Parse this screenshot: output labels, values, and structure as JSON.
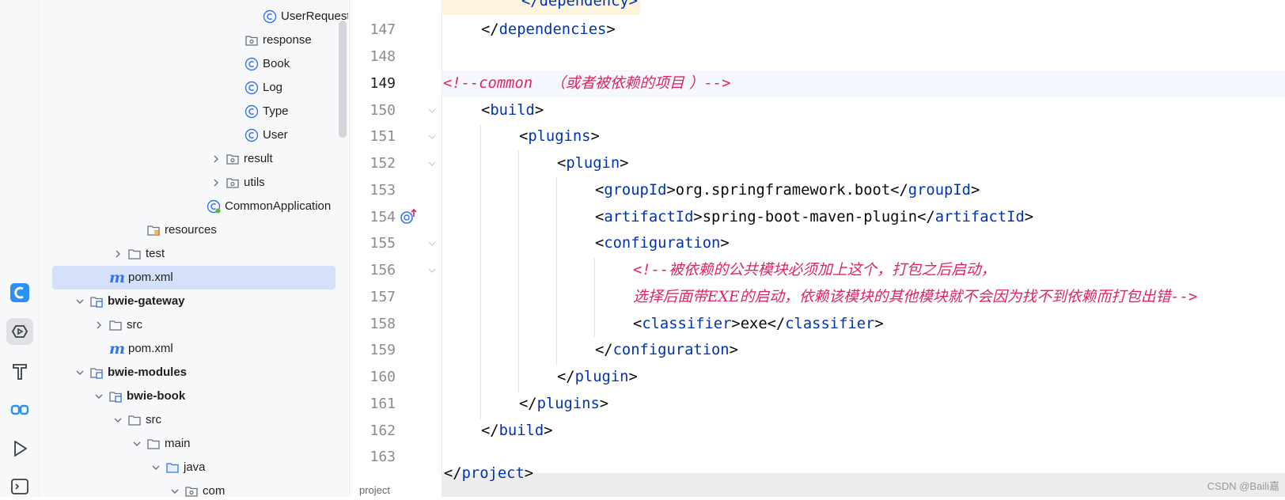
{
  "tree": {
    "items": [
      {
        "label": "UserRequest",
        "icon": "class-icon"
      },
      {
        "label": "response",
        "icon": "package-icon"
      },
      {
        "label": "Book",
        "icon": "class-icon"
      },
      {
        "label": "Log",
        "icon": "class-icon"
      },
      {
        "label": "Type",
        "icon": "class-icon"
      },
      {
        "label": "User",
        "icon": "class-icon"
      },
      {
        "label": "result",
        "icon": "package-icon"
      },
      {
        "label": "utils",
        "icon": "package-icon"
      },
      {
        "label": "CommonApplication",
        "icon": "spring-boot-class-icon"
      },
      {
        "label": "resources",
        "icon": "resources-folder-icon"
      },
      {
        "label": "test",
        "icon": "folder-icon"
      },
      {
        "label": "pom.xml",
        "icon": "maven-icon"
      },
      {
        "label": "bwie-gateway",
        "icon": "module-icon"
      },
      {
        "label": "src",
        "icon": "folder-icon"
      },
      {
        "label": "pom.xml",
        "icon": "maven-icon"
      },
      {
        "label": "bwie-modules",
        "icon": "module-icon"
      },
      {
        "label": "bwie-book",
        "icon": "module-icon"
      },
      {
        "label": "src",
        "icon": "folder-icon"
      },
      {
        "label": "main",
        "icon": "folder-icon"
      },
      {
        "label": "java",
        "icon": "source-folder-icon"
      },
      {
        "label": "com",
        "icon": "package-icon"
      }
    ],
    "maven_glyph": "m"
  },
  "editor": {
    "line_numbers": [
      "147",
      "148",
      "149",
      "150",
      "151",
      "152",
      "153",
      "154",
      "155",
      "156",
      "157",
      "158",
      "159",
      "160",
      "161",
      "162",
      "163"
    ],
    "current_line": "149",
    "top_partial_text": "</dependency>",
    "lines": {
      "l147": {
        "open": "</",
        "tag": "dependencies",
        "close": ">"
      },
      "l149_comment": "<!--common",
      "l149_zh": "（或者被依赖的项目 ）",
      "l149_end": "-->",
      "l150": {
        "open": "<",
        "tag": "build",
        "close": ">"
      },
      "l151": {
        "open": "<",
        "tag": "plugins",
        "close": ">"
      },
      "l152": {
        "open": "<",
        "tag": "plugin",
        "close": ">"
      },
      "l153": {
        "tag": "groupId",
        "value": "org.springframework.boot"
      },
      "l154": {
        "tag": "artifactId",
        "value": "spring-boot-maven-plugin"
      },
      "l155": {
        "open": "<",
        "tag": "configuration",
        "close": ">"
      },
      "l156_comment": "<!--",
      "l156_zh": "被依赖的公共模块必须加上这个，打包之后启动，",
      "l157_zh": "选择后面带EXE的启动，依赖该模块的其他模块就不会因为找不到依赖而打包出错",
      "l157_end": "-->",
      "l158": {
        "tag": "classifier",
        "value": "exe"
      },
      "l159": {
        "open": "</",
        "tag": "configuration",
        "close": ">"
      },
      "l160": {
        "open": "</",
        "tag": "plugin",
        "close": ">"
      },
      "l161": {
        "open": "</",
        "tag": "plugins",
        "close": ">"
      },
      "l162": {
        "open": "</",
        "tag": "build",
        "close": ">"
      },
      "l164": {
        "open": "</",
        "tag": "project",
        "close": ">"
      }
    }
  },
  "breadcrumb": "project",
  "watermark": "CSDN @Baili嘉",
  "colors": {
    "tag": "#0033b3",
    "comment": "#e0245e",
    "accent": "#3574f0",
    "selection": "#d5e1fb"
  }
}
